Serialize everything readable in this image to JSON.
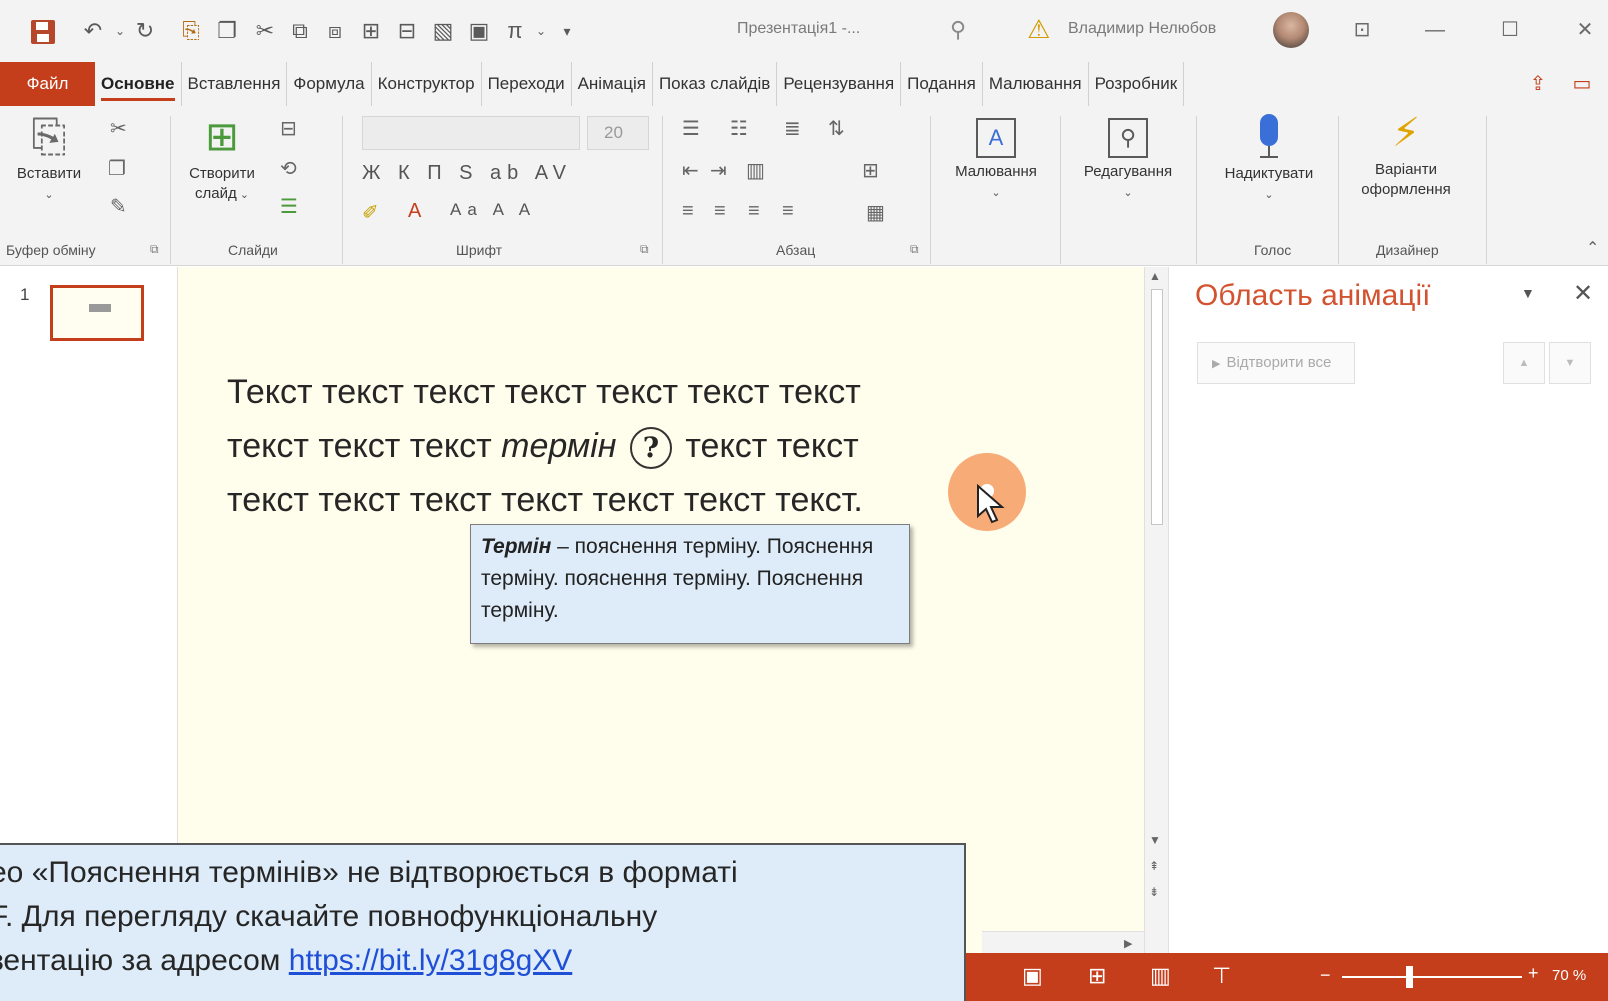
{
  "titlebar": {
    "title": "Презентація1 -...",
    "user_name": "Владимир Нелюбов"
  },
  "tabs": {
    "file": "Файл",
    "items": [
      {
        "label": "Основне",
        "active": true
      },
      {
        "label": "Вставлення"
      },
      {
        "label": "Формула"
      },
      {
        "label": "Конструктор"
      },
      {
        "label": "Переходи"
      },
      {
        "label": "Анімація"
      },
      {
        "label": "Показ слайдів"
      },
      {
        "label": "Рецензування"
      },
      {
        "label": "Подання"
      },
      {
        "label": "Малювання"
      },
      {
        "label": "Розробник"
      }
    ]
  },
  "ribbon": {
    "paste_label": "Вставити",
    "clipboard_group": "Буфер обміну",
    "new_slide_line1": "Створити",
    "new_slide_line2": "слайд",
    "slides_group": "Слайди",
    "font_size": "20",
    "font_group": "Шрифт",
    "font_row1": "Ж К П S ab AV",
    "font_row2": "Aa A A",
    "paragraph_group": "Абзац",
    "drawing_label": "Малювання",
    "editing_label": "Редагування",
    "dictate_label": "Надиктувати",
    "voice_group": "Голос",
    "design_ideas_line1": "Варіанти",
    "design_ideas_line2": "оформлення",
    "designer_group": "Дизайнер"
  },
  "thumbs": {
    "slide_number": "1"
  },
  "slide": {
    "line1": "Текст текст текст текст текст текст текст",
    "line2_before": "текст текст текст ",
    "line2_term": "термін",
    "line2_qmark": "?",
    "line2_after": " текст текст",
    "line3": "текст текст текст текст текст текст текст.",
    "tooltip_term": "Термін",
    "tooltip_rest": " – пояснення терміну. Пояснення терміну. пояснення терміну. Пояснення терміну."
  },
  "anim_pane": {
    "title": "Область анімації",
    "play_all": "Відтворити все"
  },
  "statusbar": {
    "zoom": "70 %",
    "zoom_fraction": 0.37
  },
  "notice": {
    "line1": "ео «Пояснення термінів» не відтворюється в форматі",
    "line2": "F. Для перегляду скачайте повнофункціональну",
    "line3_prefix": "зентацію за адресом ",
    "link": "https://bit.ly/31g8gXV"
  },
  "colors": {
    "accent": "#c43e1c",
    "slide_bg": "#fffdeb",
    "tooltip_bg": "#ddecf8",
    "anim_title": "#d35230",
    "link": "#1f4fd6"
  }
}
